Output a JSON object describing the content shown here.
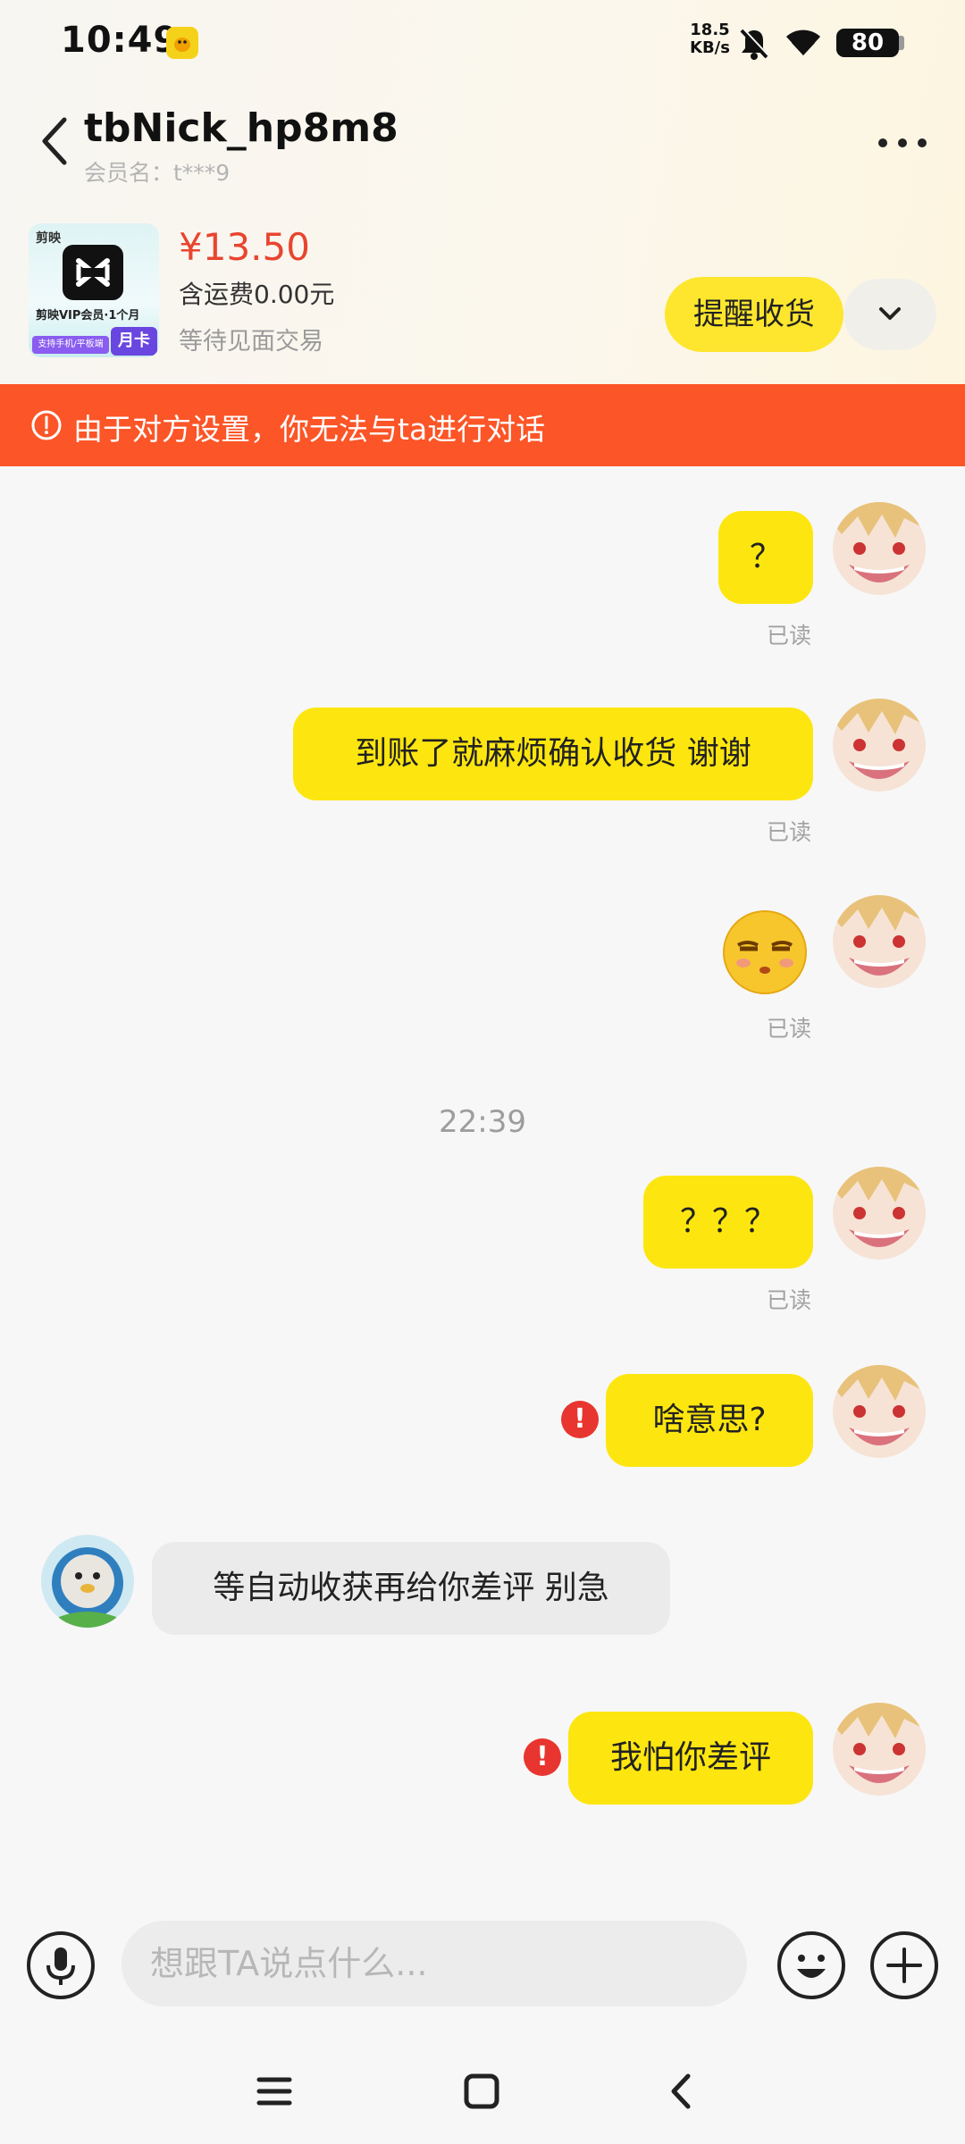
{
  "status_bar": {
    "time": "10:49",
    "net_speed_value": "18.5",
    "net_speed_unit": "KB/s",
    "battery": "80"
  },
  "header": {
    "nickname": "tbNick_hp8m8",
    "member_label": "会员名：t***9"
  },
  "order": {
    "thumb_brand": "剪映",
    "thumb_title": "剪映VIP会员·1个月",
    "thumb_tag": "月卡",
    "thumb_support": "支持手机/平板端",
    "price": "¥13.50",
    "shipping": "含运费0.00元",
    "status": "等待见面交易",
    "remind_button": "提醒收货"
  },
  "banner": {
    "text": "由于对方设置，你无法与ta进行对话"
  },
  "messages": [
    {
      "from": "me",
      "text": "？",
      "read": "已读"
    },
    {
      "from": "me",
      "text": "到账了就麻烦确认收货 谢谢",
      "read": "已读"
    },
    {
      "from": "me",
      "type": "emoji",
      "emoji": "unamused-face",
      "read": "已读"
    },
    {
      "from": "me",
      "text": "？？？",
      "read": "已读"
    },
    {
      "from": "me",
      "text": "啥意思?",
      "failed": true
    },
    {
      "from": "other",
      "text": "等自动收获再给你差评 别急"
    },
    {
      "from": "me",
      "text": "我怕你差评",
      "failed": true
    }
  ],
  "timestamp": "22:39",
  "input": {
    "placeholder": "想跟TA说点什么..."
  },
  "colors": {
    "bubble_me": "#fde60f",
    "bubble_other": "#ebebeb",
    "banner": "#fc5527",
    "price": "#e8452f",
    "error": "#e9352f"
  },
  "icons": [
    "back-icon",
    "more-icon",
    "chevron-down-icon",
    "warning-icon",
    "mic-icon",
    "emoji-icon",
    "plus-icon",
    "nav-menu-icon",
    "nav-home-icon",
    "nav-back-icon"
  ]
}
